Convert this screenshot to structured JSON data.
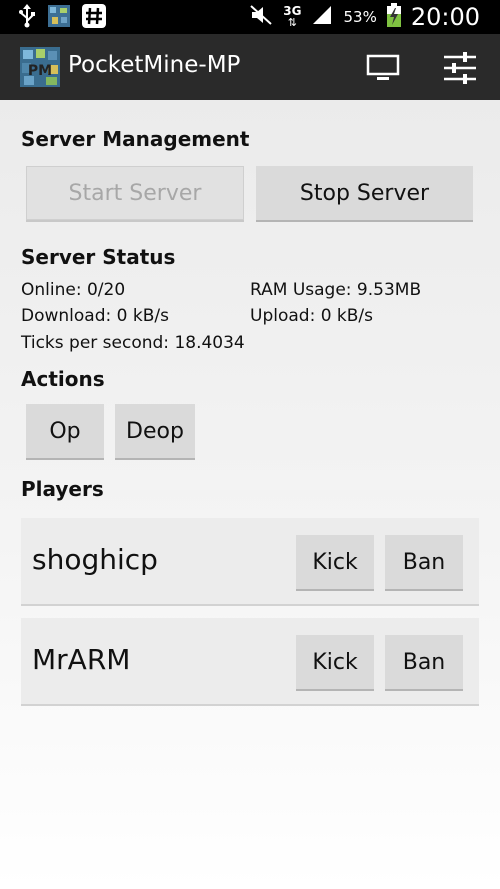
{
  "statusbar": {
    "battery_percent": "53%",
    "network_type": "3G",
    "time": "20:00",
    "icons": [
      "usb-icon",
      "pocketmine-notification-icon",
      "hash-icon",
      "mute-icon",
      "signal-icon",
      "battery-charging-icon"
    ]
  },
  "actionbar": {
    "title": "PocketMine-MP",
    "icons": [
      "monitor-icon",
      "sliders-icon"
    ]
  },
  "server_management": {
    "title": "Server Management",
    "start_label": "Start Server",
    "stop_label": "Stop Server"
  },
  "server_status": {
    "title": "Server Status",
    "online": "Online: 0/20",
    "ram": "RAM Usage: 9.53MB",
    "download": "Download: 0 kB/s",
    "upload": "Upload: 0 kB/s",
    "ticks": "Ticks per second: 18.4034"
  },
  "actions": {
    "title": "Actions",
    "op_label": "Op",
    "deop_label": "Deop"
  },
  "players": {
    "title": "Players",
    "kick_label": "Kick",
    "ban_label": "Ban",
    "items": [
      {
        "name": "shoghicp"
      },
      {
        "name": "MrARM"
      }
    ]
  },
  "colors": {
    "statusbar_bg": "#000000",
    "actionbar_bg": "#2a2a2a",
    "button_bg": "#dadada",
    "disabled_text": "#a7a7a7"
  }
}
